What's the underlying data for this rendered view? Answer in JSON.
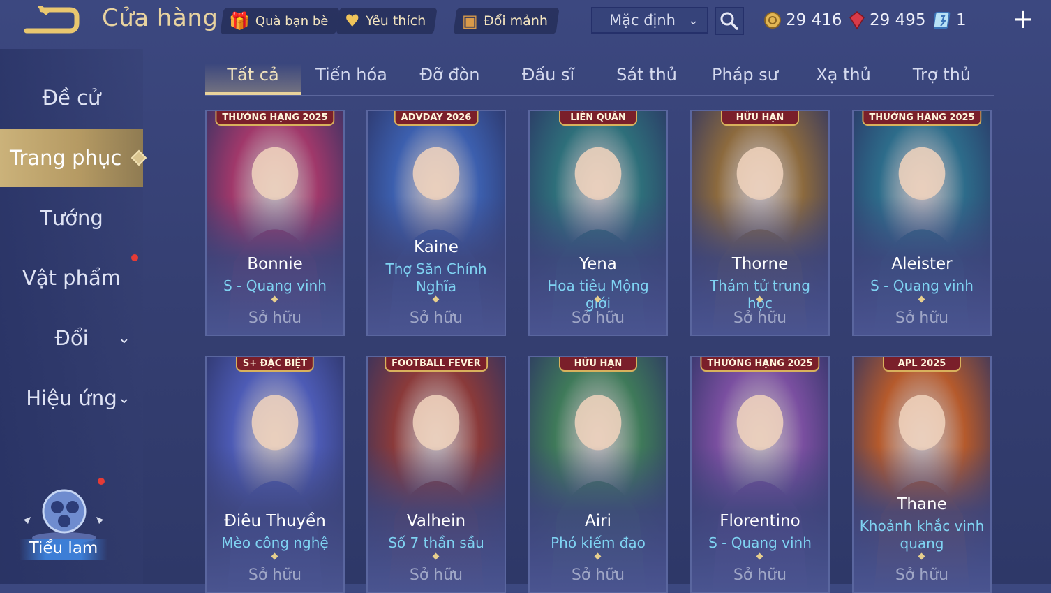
{
  "header": {
    "title": "Cửa hàng",
    "gift_label": "Quà bạn bè",
    "favorite_label": "Yêu thích",
    "exchange_label": "Đổi mảnh",
    "sort_value": "Mặc định",
    "gold": "29 416",
    "vouchers": "29 495",
    "tickets": "1"
  },
  "sidebar": {
    "items": [
      "Đề cử",
      "Trang phục",
      "Tướng",
      "Vật phẩm",
      "Đổi",
      "Hiệu ứng"
    ],
    "bonus_label": "Tiểu lam"
  },
  "tabs": [
    "Tất cả",
    "Tiến hóa",
    "Đỡ đòn",
    "Đấu sĩ",
    "Sát thủ",
    "Pháp sư",
    "Xạ thủ",
    "Trợ thủ"
  ],
  "owned_label": "Sở hữu",
  "cards": [
    {
      "name": "Bonnie",
      "subtitle": "S - Quang vinh",
      "badge": "THƯỞNG HẠNG 2025",
      "color": "#a0386a"
    },
    {
      "name": "Kaine",
      "subtitle": "Thợ Săn Chính Nghĩa",
      "badge": "ADVDAY 2026",
      "color": "#3c5fae"
    },
    {
      "name": "Yena",
      "subtitle": "Hoa tiêu Mộng giới",
      "badge": "LIÊN QUÂN",
      "color": "#2e6f7a"
    },
    {
      "name": "Thorne",
      "subtitle": "Thám tử trung học",
      "badge": "HỮU HẠN",
      "color": "#8c6a3e"
    },
    {
      "name": "Aleister",
      "subtitle": "S - Quang vinh",
      "badge": "THƯỞNG HẠNG 2025",
      "color": "#2d6c8a"
    },
    {
      "name": "Điêu Thuyền",
      "subtitle": "Mèo công nghệ",
      "badge": "S+ ĐẶC BIỆT",
      "color": "#4d5bb5"
    },
    {
      "name": "Valhein",
      "subtitle": "Số 7 thần sầu",
      "badge": "FOOTBALL FEVER",
      "color": "#8a3a3a"
    },
    {
      "name": "Airi",
      "subtitle": "Phó kiếm đạo",
      "badge": "HỮU HẠN",
      "color": "#3f7a5a"
    },
    {
      "name": "Florentino",
      "subtitle": "S - Quang vinh",
      "badge": "THƯỞNG HẠNG 2025",
      "color": "#7a4fa0"
    },
    {
      "name": "Thane",
      "subtitle": "Khoảnh khắc vinh quang",
      "badge": "APL 2025",
      "color": "#b55a2c"
    }
  ]
}
